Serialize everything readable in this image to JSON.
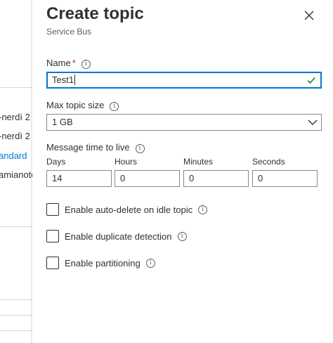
{
  "background_blade": {
    "rows": [
      "-nerdì 2",
      "-nerdì 2",
      "andard",
      "amianote"
    ]
  },
  "header": {
    "title": "Create topic",
    "subtitle": "Service Bus",
    "close_icon": "close-icon"
  },
  "form": {
    "name": {
      "label": "Name",
      "required_marker": "*",
      "value": "Test1",
      "valid_icon": "checkmark-icon"
    },
    "max_topic_size": {
      "label": "Max topic size",
      "selected": "1 GB"
    },
    "ttl": {
      "label": "Message time to live",
      "fields": [
        {
          "label": "Days",
          "value": "14"
        },
        {
          "label": "Hours",
          "value": "0"
        },
        {
          "label": "Minutes",
          "value": "0"
        },
        {
          "label": "Seconds",
          "value": "0"
        }
      ]
    },
    "options": [
      {
        "label": "Enable auto-delete on idle topic",
        "checked": false,
        "has_info": true
      },
      {
        "label": "Enable duplicate detection",
        "checked": false,
        "has_info": true
      },
      {
        "label": "Enable partitioning",
        "checked": false,
        "has_info": true
      }
    ]
  },
  "colors": {
    "accent": "#0078d4",
    "required": "#a4262c",
    "valid": "#107c10"
  }
}
